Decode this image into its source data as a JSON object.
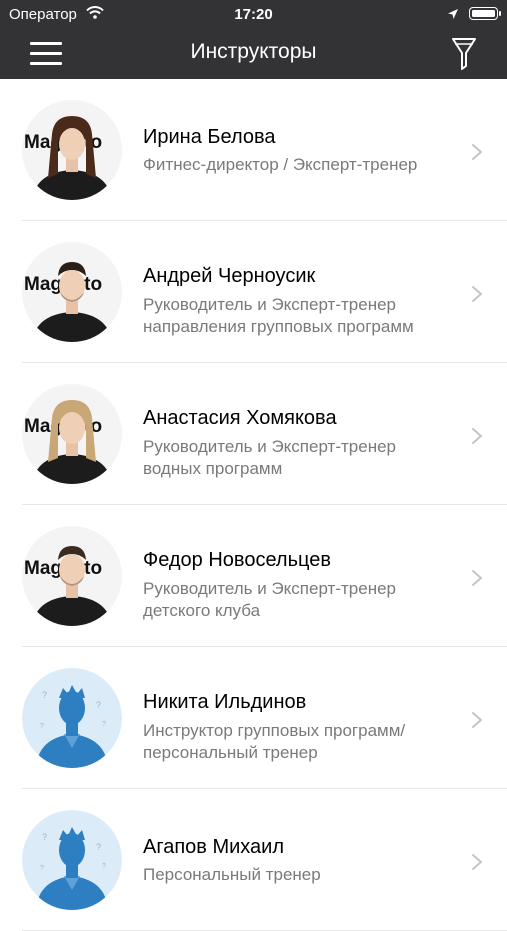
{
  "status_bar": {
    "carrier": "Оператор",
    "time": "17:20"
  },
  "header": {
    "title": "Инструкторы"
  },
  "instructors": [
    {
      "name": "Ирина Белова",
      "role_lines": [
        "Фитнес-директор / Эксперт-тренер"
      ],
      "avatar": "photo",
      "gender": "female",
      "hair": "#4a2a1a",
      "logo_text": "Magneto"
    },
    {
      "name": "Андрей Черноусик",
      "role_lines": [
        "Руководитель и Эксперт-тренер",
        "направления групповых программ"
      ],
      "avatar": "photo",
      "gender": "male",
      "hair": "#2b2018",
      "logo_text": "Magneto"
    },
    {
      "name": "Анастасия Хомякова",
      "role_lines": [
        "Руководитель и Эксперт-тренер",
        "водных программ"
      ],
      "avatar": "photo",
      "gender": "female",
      "hair": "#c9a777",
      "logo_text": "Magneto"
    },
    {
      "name": "Федор Новосельцев",
      "role_lines": [
        "Руководитель и Эксперт-тренер",
        "детского клуба"
      ],
      "avatar": "photo",
      "gender": "male",
      "hair": "#3a2a20",
      "logo_text": "Magneto"
    },
    {
      "name": "Никита Ильдинов",
      "role_lines": [
        "Инструктор групповых программ/",
        "персональный тренер"
      ],
      "avatar": "placeholder"
    },
    {
      "name": "Агапов Михаил",
      "role_lines": [
        "Персональный тренер"
      ],
      "avatar": "placeholder"
    }
  ],
  "colors": {
    "header_bg": "#333335",
    "placeholder_bg": "#dcebf8",
    "placeholder_figure": "#2e7fc1"
  }
}
